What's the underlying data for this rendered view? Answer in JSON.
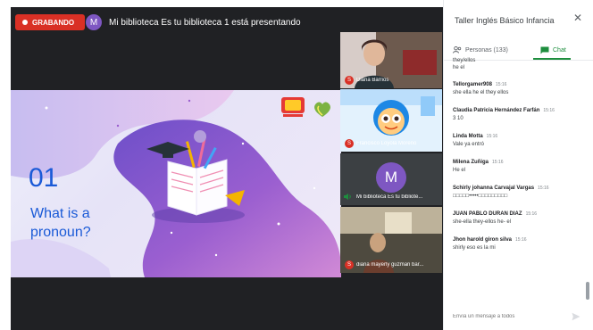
{
  "call": {
    "recording_label": "GRABANDO",
    "presenter_initial": "M",
    "presenter_text": "Mi biblioteca Es tu biblioteca 1 está presentando"
  },
  "slide": {
    "number": "01",
    "title": "What is a pronoun?"
  },
  "tiles": [
    {
      "label": "Diana Barrios",
      "badge": "S"
    },
    {
      "label": "Francisco Loyola Moreno",
      "badge": "S"
    },
    {
      "label": "Mi biblioteca Es tu bibliote...",
      "avatar": "M"
    },
    {
      "label": "diana mayerly guzman bar...",
      "badge": "S"
    }
  ],
  "panel": {
    "title": "Taller Inglés Básico Infancia",
    "tab_people": "Personas (133)",
    "tab_chat": "Chat",
    "compose_placeholder": "Envía un mensaje a todos",
    "top_lines": [
      "they/ellos",
      "he el"
    ],
    "messages": [
      {
        "author": "Tellorgamer908",
        "time": "15:16",
        "text": "she ella he el they ellos"
      },
      {
        "author": "Claudia Patricia Hernández Farfán",
        "time": "15:16",
        "text": "3 10"
      },
      {
        "author": "Linda Motta",
        "time": "15:16",
        "text": "Vale ya entró"
      },
      {
        "author": "Milena Zuñiga",
        "time": "15:16",
        "text": "He el"
      },
      {
        "author": "Schirly johanna Carvajal Vargas",
        "time": "15:16",
        "text": "□□□□□•••••□□□□□□□□□"
      },
      {
        "author": "JUAN PABLO DURAN DIAZ",
        "time": "15:16",
        "text": "she-ella they-ellos he- el"
      },
      {
        "author": "Jhon harold giron silva",
        "time": "15:16",
        "text": "shirly eso es la mi"
      }
    ]
  },
  "colors": {
    "stage_bg": "#202124",
    "record_red": "#d93025",
    "presenter_purple": "#7e57c2",
    "chat_green": "#1e8e3e",
    "slide_text_blue": "#1a5ad7"
  }
}
